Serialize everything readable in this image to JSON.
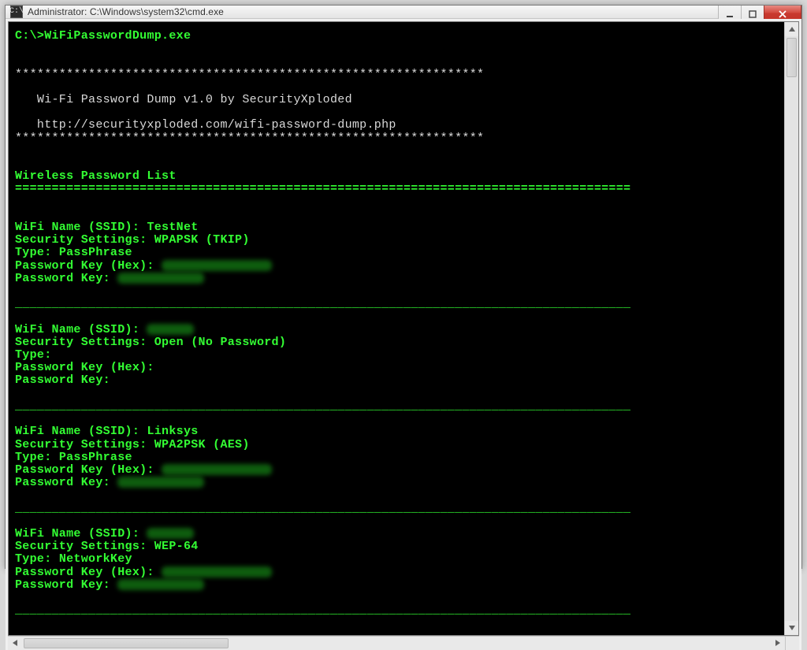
{
  "window": {
    "title": "Administrator: C:\\Windows\\system32\\cmd.exe",
    "iconText": "C:\\"
  },
  "cmd": {
    "prompt": "C:\\>",
    "command": "WiFiPasswordDump.exe"
  },
  "banner": {
    "stars": "****************************************************************",
    "prog": "   Wi-Fi Password Dump v1.0 by SecurityXploded",
    "url": "   http://securityxploded.com/wifi-password-dump.php"
  },
  "section": {
    "heading": "Wireless Password List",
    "rule": "====================================================================================",
    "dashes": "____________________________________________________________________________________"
  },
  "labels": {
    "ssid": "WiFi Name (SSID): ",
    "sec": "Security Settings: ",
    "type": "Type: ",
    "hex": "Password Key (Hex): ",
    "key": "Password Key: "
  },
  "entries": [
    {
      "ssid": "TestNet",
      "sec": "WPAPSK (TKIP)",
      "type": "PassPhrase",
      "hexMasked": true,
      "keyMasked": true
    },
    {
      "ssidMasked": true,
      "sec": "Open (No Password)",
      "type": "",
      "hexMasked": false,
      "keyMasked": false
    },
    {
      "ssid": "Linksys",
      "sec": "WPA2PSK (AES)",
      "type": "PassPhrase",
      "hexMasked": true,
      "keyMasked": true
    },
    {
      "ssidMasked": true,
      "sec": "WEP-64",
      "type": "NetworkKey",
      "hexMasked": true,
      "keyMasked": true
    }
  ]
}
